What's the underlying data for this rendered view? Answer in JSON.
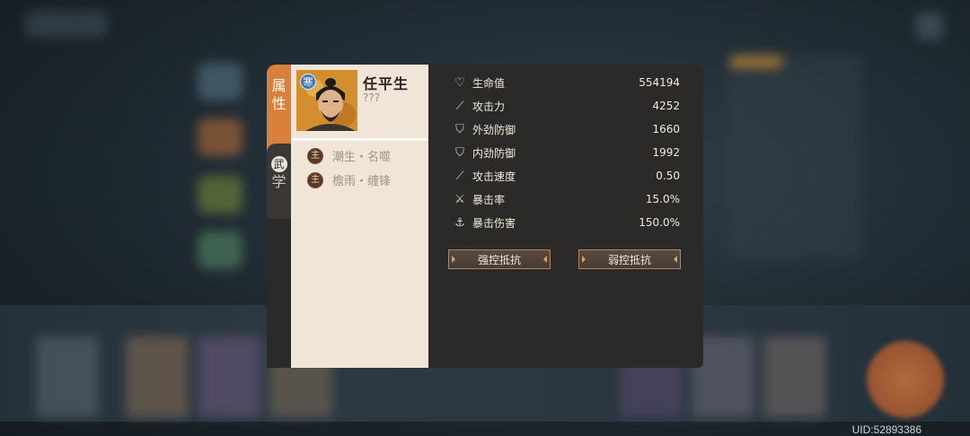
{
  "uid": "UID:52893386",
  "tabs": {
    "attributes": [
      "属",
      "性"
    ],
    "martial": [
      "武",
      "学"
    ]
  },
  "character": {
    "name": "任平生",
    "subtitle": "???",
    "element_badge": "寒"
  },
  "skills": [
    {
      "icon": "主",
      "name": "潮生・名噬"
    },
    {
      "icon": "主",
      "name": "檐雨・缠锋"
    }
  ],
  "stats": [
    {
      "icon": "heart-icon",
      "glyph": "♡",
      "label": "生命值",
      "value": "554194"
    },
    {
      "icon": "sword-icon",
      "glyph": "⟋",
      "label": "攻击力",
      "value": "4252"
    },
    {
      "icon": "shield-icon",
      "glyph": "⛉",
      "label": "外劲防御",
      "value": "1660"
    },
    {
      "icon": "shield-icon",
      "glyph": "⛉",
      "label": "内劲防御",
      "value": "1992"
    },
    {
      "icon": "dagger-icon",
      "glyph": "⟋",
      "label": "攻击速度",
      "value": "0.50"
    },
    {
      "icon": "crit-icon",
      "glyph": "⚔",
      "label": "暴击率",
      "value": "15.0%"
    },
    {
      "icon": "anchor-icon",
      "glyph": "⚓",
      "label": "暴击伤害",
      "value": "150.0%"
    }
  ],
  "buttons": {
    "strong_control": "强控抵抗",
    "weak_control": "弱控抵抗"
  }
}
